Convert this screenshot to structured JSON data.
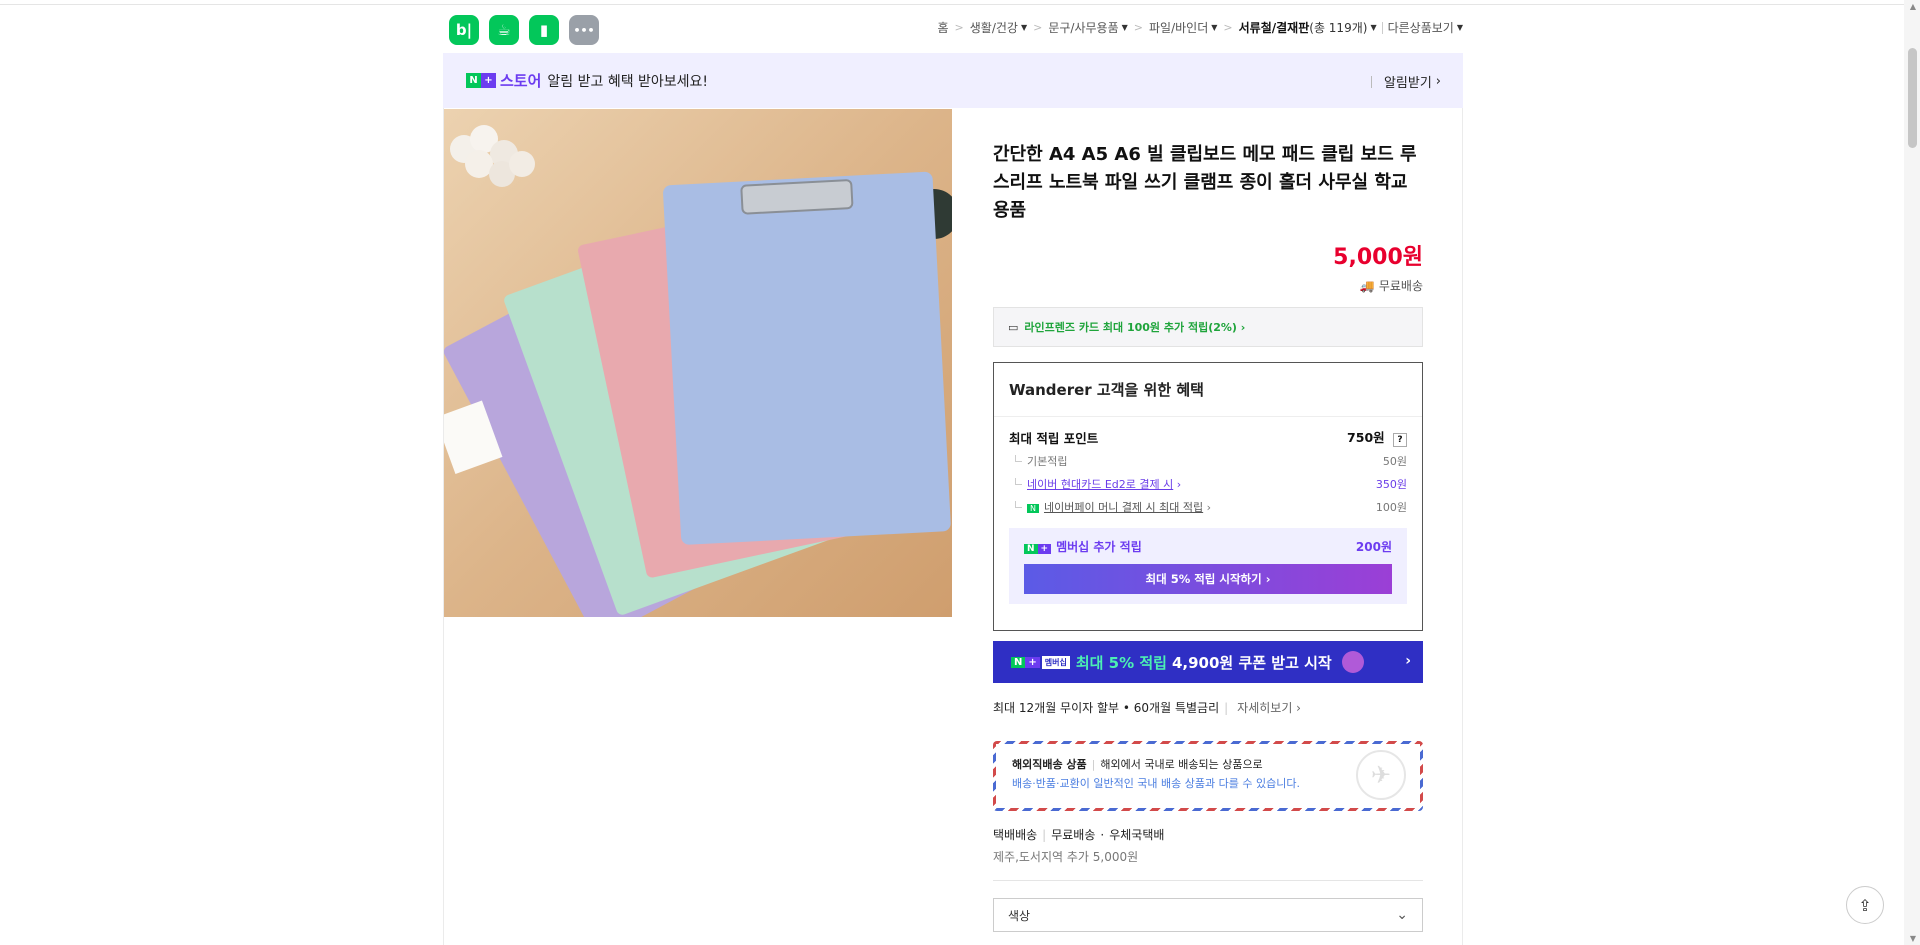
{
  "header": {
    "apps": [
      {
        "name": "blog",
        "glyph": "b|",
        "color": "#03c75a"
      },
      {
        "name": "cafe",
        "glyph": "☕",
        "color": "#03c75a"
      },
      {
        "name": "bookmark",
        "glyph": "▮",
        "color": "#03c75a"
      },
      {
        "name": "more",
        "glyph": "•••",
        "color": "#9aa0a8"
      }
    ],
    "breadcrumbs": [
      {
        "label": "홈",
        "dropdown": false
      },
      {
        "label": "생활/건강",
        "dropdown": true
      },
      {
        "label": "문구/사무용품",
        "dropdown": true
      },
      {
        "label": "파일/바인더",
        "dropdown": true
      },
      {
        "label": "서류철/결재판",
        "dropdown": true,
        "current": true,
        "count": "(총 119개)"
      }
    ],
    "other_products": "다른상품보기"
  },
  "banner": {
    "store_label": "스토어",
    "text": "알림 받고 혜택 받아보세요!",
    "alarm_button": "알림받기"
  },
  "product": {
    "title": "간단한 A4 A5 A6 빌 클립보드 메모 패드 클립 보드 루스리프 노트북 파일 쓰기 클램프 종이 홀더 사무실 학교 용품",
    "price": "5,000원",
    "shipping": "무료배송",
    "card_benefit": "라인프렌즈 카드 최대 100원 추가 적립(2%) ›"
  },
  "benefits": {
    "header": "Wanderer 고객을 위한 혜택",
    "max_points_label": "최대 적립 포인트",
    "max_points_value": "750원",
    "help": "?",
    "rows": [
      {
        "label": "기본적립",
        "value": "50원"
      },
      {
        "label": "네이버 현대카드 Ed2로 결제 시",
        "value": "350원"
      },
      {
        "label": "네이버페이 머니 결제 시 최대 적립",
        "value": "100원"
      }
    ],
    "membership_label": "멤버십 추가 적립",
    "membership_value": "200원",
    "membership_button": "최대 5% 적립 시작하기 ›"
  },
  "promo_banner": {
    "membership_tag": "멤버십",
    "highlight": "최대 5% 적립",
    "text": "4,900원 쿠폰 받고 시작",
    "arrow": "›"
  },
  "installment": {
    "text": "최대 12개월 무이자 할부 • 60개월 특별금리",
    "more": "자세히보기 ›"
  },
  "overseas": {
    "title": "해외직배송 상품",
    "desc": "해외에서 국내로 배송되는 상품으로",
    "note": "배송·반품·교환이 일반적인 국내 배송 상품과 다를 수 있습니다."
  },
  "shipping_info": {
    "method": "택배배송",
    "fee": "무료배송",
    "carrier": "우체국택배",
    "extra": "제주,도서지역 추가 5,000원"
  },
  "option_select": {
    "label": "색상"
  }
}
